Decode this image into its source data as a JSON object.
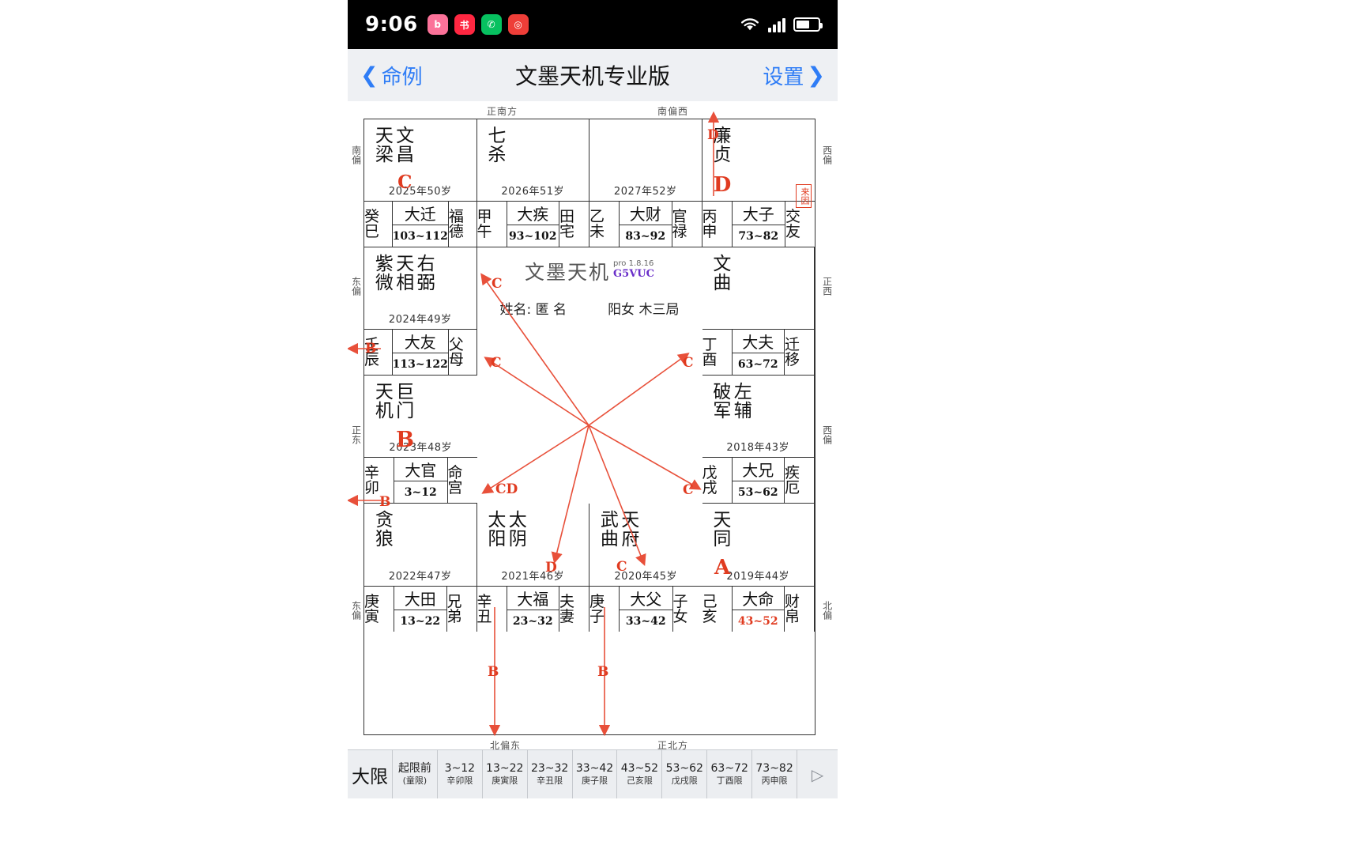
{
  "status_bar": {
    "time": "9:06",
    "app_icons": [
      "bilibili-icon",
      "xiaohongshu-icon",
      "wechat-icon",
      "instagram-icon"
    ],
    "wifi": "wifi-icon",
    "signal": "signal-icon",
    "battery": "battery-icon"
  },
  "nav": {
    "back_label": "命例",
    "title": "文墨天机专业版",
    "settings_label": "设置"
  },
  "compass": {
    "top_left": "正南方",
    "top_right": "南偏西",
    "left_top": "南偏",
    "left_mid": "东偏",
    "left_low": "正东",
    "left_bottom": "东偏",
    "right_top": "西偏",
    "right_mid": "正西",
    "right_low": "西偏",
    "right_bottom": "北偏",
    "bottom_left": "北偏东",
    "bottom_right": "正北方"
  },
  "center": {
    "brand": "文墨天机",
    "version": "pro 1.8.16",
    "code": "G5VUC",
    "name_label": "姓名:",
    "name_value": "匿 名",
    "gender": "阳女",
    "ju": "木三局",
    "lai_yin": "来因"
  },
  "palaces": [
    {
      "stars": [
        "天梁",
        "文昌"
      ],
      "sihua": "C",
      "year": "2025年50岁",
      "gz": "癸巳",
      "daxian": "大迁",
      "range": "103~112",
      "gong": "福德",
      "range_red": false
    },
    {
      "stars": [
        "七杀"
      ],
      "sihua": "",
      "year": "2026年51岁",
      "gz": "甲午",
      "daxian": "大疾",
      "range": "93~102",
      "gong": "田宅",
      "range_red": false
    },
    {
      "stars": [],
      "sihua": "",
      "year": "2027年52岁",
      "gz": "乙未",
      "daxian": "大财",
      "range": "83~92",
      "gong": "官禄",
      "range_red": false
    },
    {
      "stars": [
        "廉贞"
      ],
      "sihua": "D",
      "year": "",
      "gz": "丙申",
      "daxian": "大子",
      "range": "73~82",
      "gong": "交友",
      "range_red": false
    },
    {
      "stars": [
        "紫微",
        "天相",
        "右弼"
      ],
      "sihua": "",
      "year": "2024年49岁",
      "gz": "壬辰",
      "daxian": "大友",
      "range": "113~122",
      "gong": "父母",
      "range_red": false
    },
    {
      "stars": [
        "文曲"
      ],
      "sihua": "",
      "year": "",
      "gz": "丁酉",
      "daxian": "大夫",
      "range": "63~72",
      "gong": "迁移",
      "range_red": false
    },
    {
      "stars": [
        "天机",
        "巨门"
      ],
      "sihua": "B",
      "year": "2023年48岁",
      "gz": "辛卯",
      "daxian": "大官",
      "range": "3~12",
      "gong": "命宫",
      "range_red": false
    },
    {
      "stars": [
        "破军",
        "左辅"
      ],
      "sihua": "",
      "year": "2018年43岁",
      "gz": "戊戌",
      "daxian": "大兄",
      "range": "53~62",
      "gong": "疾厄",
      "range_red": false
    },
    {
      "stars": [
        "贪狼"
      ],
      "sihua": "",
      "year": "2022年47岁",
      "gz": "庚寅",
      "daxian": "大田",
      "range": "13~22",
      "gong": "兄弟",
      "range_red": false
    },
    {
      "stars": [
        "太阳",
        "太阴"
      ],
      "sihua": "",
      "year": "2021年46岁",
      "gz": "辛丑",
      "daxian": "大福",
      "range": "23~32",
      "gong": "夫妻",
      "range_red": false
    },
    {
      "stars": [
        "武曲",
        "天府"
      ],
      "sihua": "",
      "year": "2020年45岁",
      "gz": "庚子",
      "daxian": "大父",
      "range": "33~42",
      "gong": "子女",
      "range_red": false
    },
    {
      "stars": [
        "天同"
      ],
      "sihua": "A",
      "year": "2019年44岁",
      "gz": "己亥",
      "daxian": "大命",
      "range": "43~52",
      "gong": "财帛",
      "range_red": true
    }
  ],
  "flow_labels": [
    "D",
    "C",
    "C",
    "C",
    "CD",
    "C",
    "B",
    "B",
    "B",
    "A",
    "D",
    "C"
  ],
  "daxian_bar": {
    "title": "大限",
    "items": [
      {
        "range": "起限前",
        "sub": "(童限)"
      },
      {
        "range": "3~12",
        "sub": "辛卯限"
      },
      {
        "range": "13~22",
        "sub": "庚寅限"
      },
      {
        "range": "23~32",
        "sub": "辛丑限"
      },
      {
        "range": "33~42",
        "sub": "庚子限"
      },
      {
        "range": "43~52",
        "sub": "己亥限"
      },
      {
        "range": "53~62",
        "sub": "戊戌限"
      },
      {
        "range": "63~72",
        "sub": "丁酉限"
      },
      {
        "range": "73~82",
        "sub": "丙申限"
      }
    ],
    "next_icon": "play-next-icon"
  }
}
